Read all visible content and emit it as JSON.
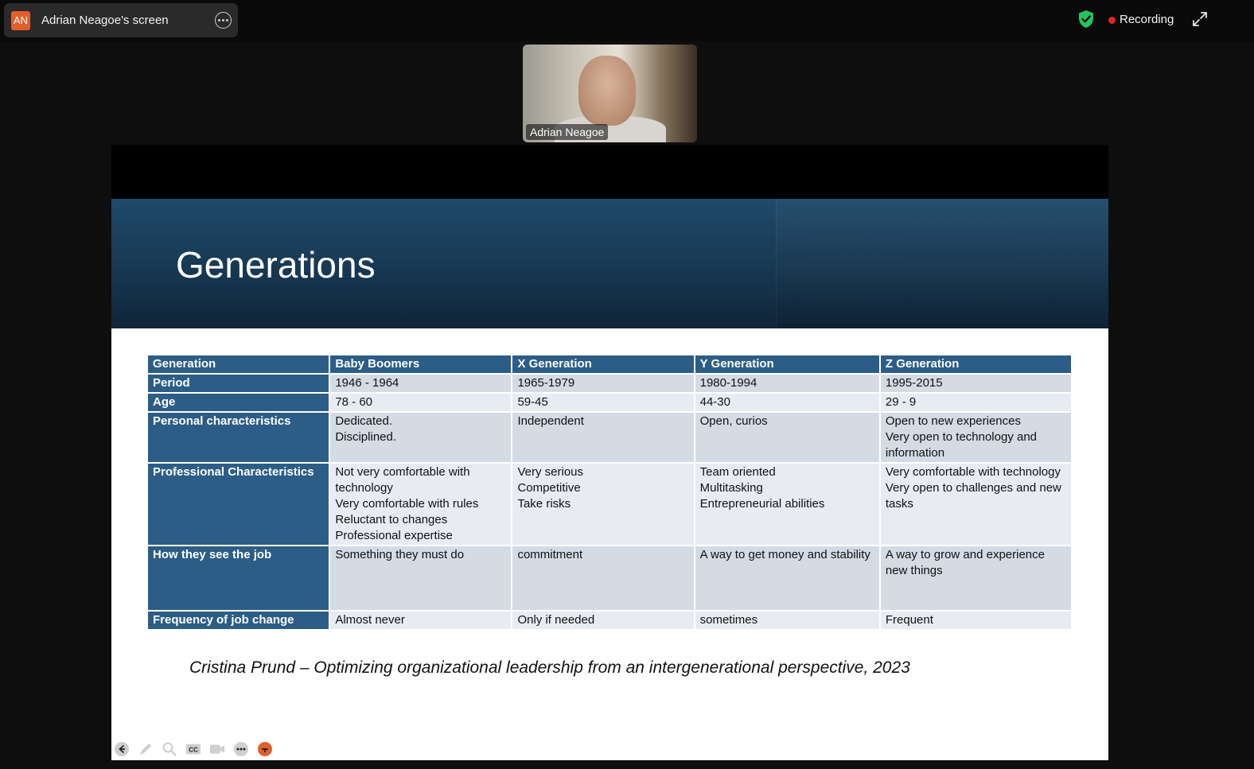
{
  "share": {
    "badge": "AN",
    "title": "Adrian Neagoe's screen"
  },
  "status": {
    "recording_label": "Recording",
    "shield_color": "#22c55e",
    "record_color": "#e02424"
  },
  "video": {
    "participant_name": "Adrian Neagoe"
  },
  "slide": {
    "title": "Generations",
    "table": {
      "headers": [
        "Generation",
        "Baby Boomers",
        "X Generation",
        "Y Generation",
        "Z Generation"
      ],
      "rows": [
        {
          "label": "Period",
          "cells": [
            [
              "1946 - 1964"
            ],
            [
              "1965-1979"
            ],
            [
              "1980-1994"
            ],
            [
              "1995-2015"
            ]
          ]
        },
        {
          "label": "Age",
          "cells": [
            [
              "78 - 60"
            ],
            [
              "59-45"
            ],
            [
              "44-30"
            ],
            [
              "29 - 9"
            ]
          ]
        },
        {
          "label": "Personal characteristics",
          "cells": [
            [
              "Dedicated.",
              "Disciplined."
            ],
            [
              "Independent"
            ],
            [
              "Open, curios"
            ],
            [
              "Open to new experiences",
              "Very open to technology and information"
            ]
          ]
        },
        {
          "label": "Professional Characteristics",
          "cells": [
            [
              "Not very comfortable with technology",
              "Very comfortable with rules",
              "Reluctant to changes",
              "Professional expertise"
            ],
            [
              "Very serious",
              "Competitive",
              "Take risks"
            ],
            [
              "Team oriented",
              "Multitasking",
              "Entrepreneurial abilities"
            ],
            [
              "Very comfortable with technology",
              "Very open to challenges and new tasks"
            ]
          ]
        },
        {
          "label": "How they see the job",
          "cells": [
            [
              "Something they must do"
            ],
            [
              "commitment"
            ],
            [
              "A way to get money and stability"
            ],
            [
              "A way to grow and experience new things"
            ]
          ]
        },
        {
          "label": "Frequency of job change",
          "cells": [
            [
              "Almost never"
            ],
            [
              "Only if needed"
            ],
            [
              "sometimes"
            ],
            [
              "Frequent"
            ]
          ]
        }
      ]
    },
    "citation": "Cristina Prund – Optimizing organizational leadership from an intergenerational perspective, 2023"
  },
  "toolbar": {
    "icons": [
      "back-arrow-icon",
      "pen-icon",
      "zoom-icon",
      "captions-icon",
      "camera-icon",
      "more-icon",
      "laser-pointer-icon"
    ]
  }
}
